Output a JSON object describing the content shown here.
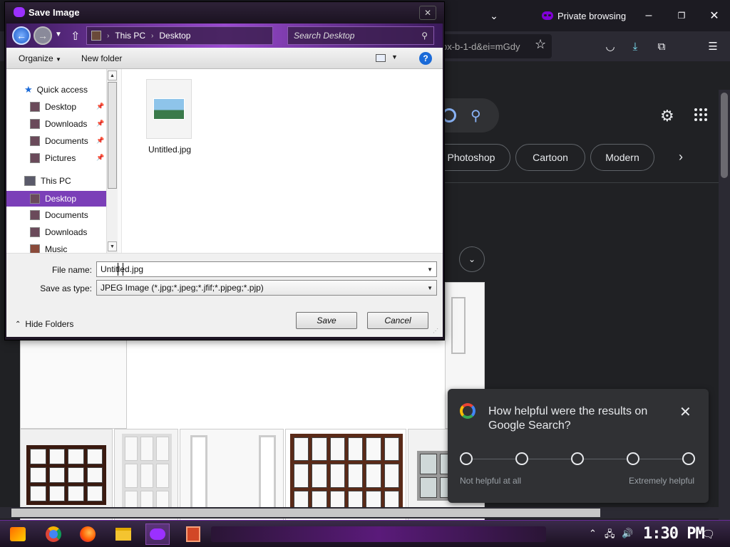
{
  "browser": {
    "private_label": "Private browsing",
    "url_fragment": "ox-b-1-d&ei=mGdy",
    "chips": [
      "Photoshop",
      "Cartoon",
      "Modern"
    ]
  },
  "feedback": {
    "question": "How helpful were the results on Google Search?",
    "low_label": "Not helpful at all",
    "high_label": "Extremely helpful"
  },
  "taskbar": {
    "clock": "1:30 PM"
  },
  "dialog": {
    "title": "Save Image",
    "breadcrumb": [
      "This PC",
      "Desktop"
    ],
    "search_placeholder": "Search Desktop",
    "toolbar": {
      "organize": "Organize",
      "new_folder": "New folder"
    },
    "nav": {
      "quick_access": "Quick access",
      "quick_items": [
        "Desktop",
        "Downloads",
        "Documents",
        "Pictures"
      ],
      "this_pc": "This PC",
      "pc_items": [
        "Desktop",
        "Documents",
        "Downloads",
        "Music"
      ],
      "selected": "Desktop"
    },
    "files": [
      {
        "name": "Untitled.jpg"
      }
    ],
    "file_name_label": "File name:",
    "file_name_value": "Untitled.jpg",
    "save_type_label": "Save as type:",
    "save_type_value": "JPEG Image (*.jpg;*.jpeg;*.jfif;*.pjpeg;*.pjp)",
    "hide_folders": "Hide Folders",
    "save_label": "Save",
    "cancel_label": "Cancel"
  }
}
